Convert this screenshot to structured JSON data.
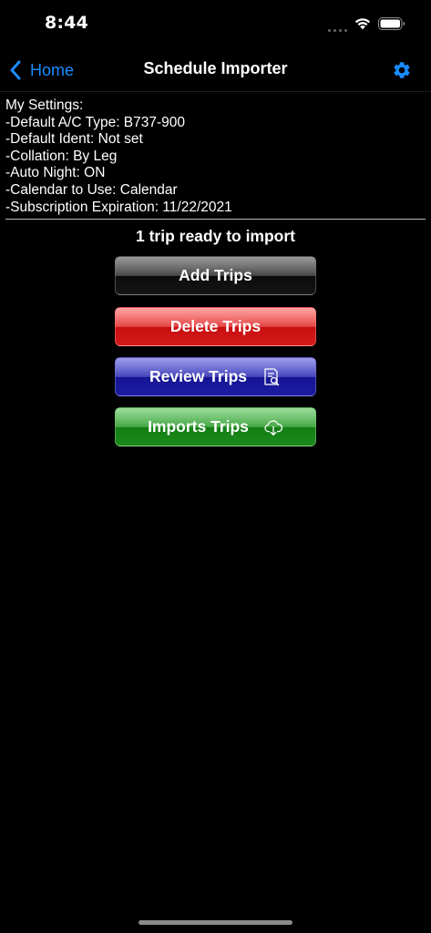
{
  "status_bar": {
    "time": "8:44",
    "signal_icon": "cellular-signal-icon",
    "wifi_icon": "wifi-icon",
    "battery_icon": "battery-icon"
  },
  "nav": {
    "back_label": "Home",
    "back_icon": "chevron-left-icon",
    "title": "Schedule Importer",
    "settings_icon": "gear-icon",
    "accent_color": "#1a8cff"
  },
  "settings": {
    "lines": [
      "My Settings:",
      "-Default A/C Type: B737-900",
      "-Default Ident: Not set",
      "-Collation: By Leg",
      "-Auto Night: ON",
      "-Calendar to Use: Calendar",
      "-Subscription Expiration: 11/22/2021"
    ]
  },
  "status_text": "1 trip ready to import",
  "buttons": {
    "add": {
      "label": "Add Trips",
      "color": "#2e2e2e"
    },
    "delete": {
      "label": "Delete Trips",
      "color": "#e02a2a"
    },
    "review": {
      "label": "Review Trips",
      "color": "#2a2ab0",
      "icon": "document-search-icon"
    },
    "import": {
      "label": "Imports Trips",
      "color": "#2a9a2a",
      "icon": "cloud-download-icon"
    }
  }
}
